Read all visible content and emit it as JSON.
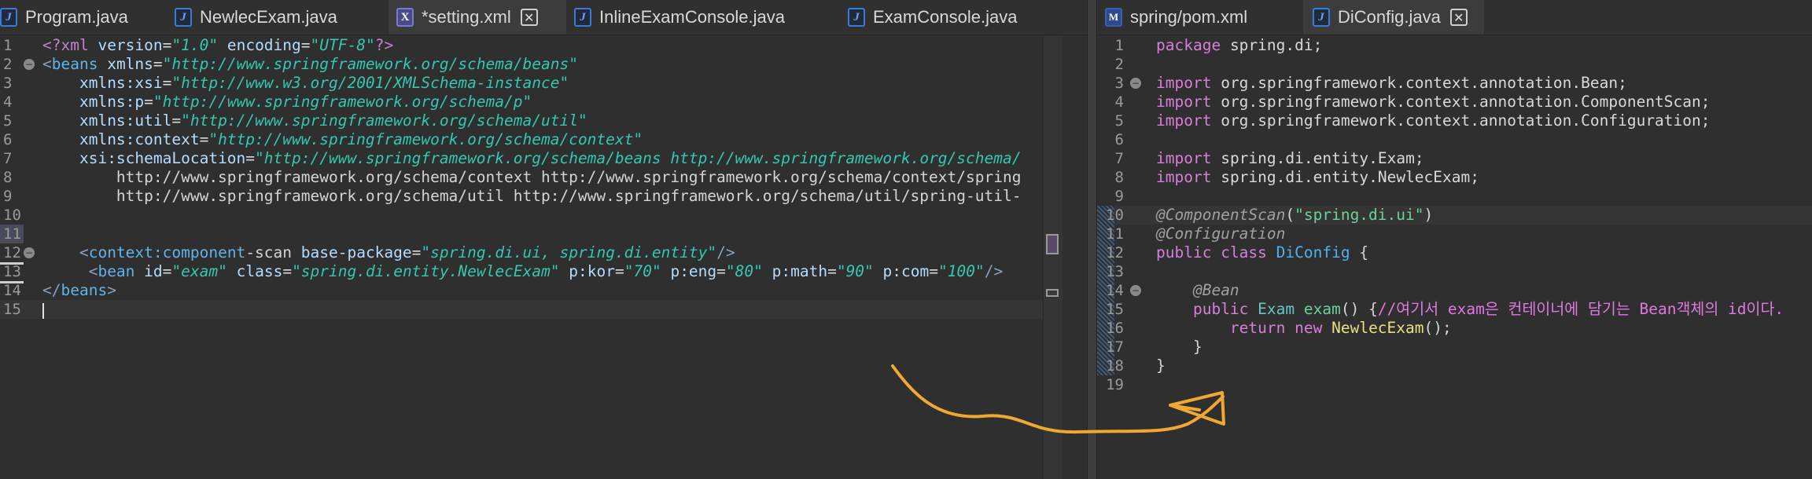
{
  "left": {
    "tabs": [
      {
        "label": "Program.java",
        "icon": "java-file-icon",
        "active": false
      },
      {
        "label": "NewlecExam.java",
        "icon": "java-file-icon",
        "active": false
      },
      {
        "label": "*setting.xml",
        "icon": "xml-file-icon",
        "active": true,
        "closable": true
      },
      {
        "label": "InlineExamConsole.java",
        "icon": "java-file-icon",
        "active": false
      },
      {
        "label": "ExamConsole.java",
        "icon": "java-file-icon",
        "active": false
      }
    ],
    "line_numbers": [
      "1",
      "2",
      "3",
      "4",
      "5",
      "6",
      "7",
      "8",
      "9",
      "10",
      "11",
      "12",
      "13",
      "14",
      "15"
    ],
    "lines": [
      "<?xml version=\"1.0\" encoding=\"UTF-8\"?>",
      "<beans xmlns=\"http://www.springframework.org/schema/beans\"",
      "    xmlns:xsi=\"http://www.w3.org/2001/XMLSchema-instance\"",
      "    xmlns:p=\"http://www.springframework.org/schema/p\"",
      "    xmlns:util=\"http://www.springframework.org/schema/util\"",
      "    xmlns:context=\"http://www.springframework.org/schema/context\"",
      "    xsi:schemaLocation=\"http://www.springframework.org/schema/beans http://www.springframework.org/schema/",
      "        http://www.springframework.org/schema/context http://www.springframework.org/schema/context/spring",
      "        http://www.springframework.org/schema/util http://www.springframework.org/schema/util/spring-util-",
      "",
      "",
      "    <context:component-scan base-package=\"spring.di.ui, spring.di.entity\"/>",
      "     <bean id=\"exam\" class=\"spring.di.entity.NewlecExam\" p:kor=\"70\" p:eng=\"80\" p:math=\"90\" p:com=\"100\"/>",
      "</beans>",
      ""
    ]
  },
  "right": {
    "tabs": [
      {
        "label": "spring/pom.xml",
        "icon": "maven-file-icon",
        "active": false
      },
      {
        "label": "DiConfig.java",
        "icon": "java-file-icon",
        "active": true,
        "closable": true
      }
    ],
    "line_numbers": [
      "1",
      "2",
      "3",
      "4",
      "5",
      "6",
      "7",
      "8",
      "9",
      "10",
      "11",
      "12",
      "13",
      "14",
      "15",
      "16",
      "17",
      "18",
      "19"
    ],
    "lines": [
      "package spring.di;",
      "",
      "import org.springframework.context.annotation.Bean;",
      "import org.springframework.context.annotation.ComponentScan;",
      "import org.springframework.context.annotation.Configuration;",
      "",
      "import spring.di.entity.Exam;",
      "import spring.di.entity.NewlecExam;",
      "",
      "@ComponentScan(\"spring.di.ui\")",
      "@Configuration",
      "public class DiConfig {",
      "",
      "    @Bean",
      "    public Exam exam() {//여기서 exam은 컨테이너에 담기는 Bean객체의 id이다.",
      "        return new NewlecExam();",
      "    }",
      "}",
      ""
    ]
  },
  "colors": {
    "background": "#2f2f2f",
    "annotation_arrow": "#f0a830",
    "tag": "#5fb3e8",
    "attr_value": "#33c7b0",
    "keyword": "#d67fd8",
    "string": "#6ad19a",
    "comment": "#e078e0"
  }
}
